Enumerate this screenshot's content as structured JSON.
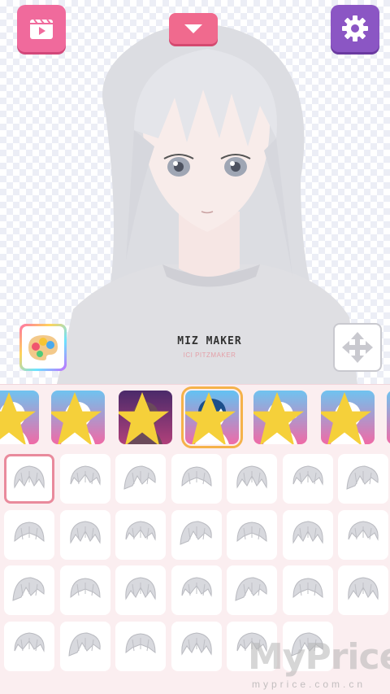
{
  "toolbar": {
    "video_icon": "video-icon",
    "dropdown_icon": "chevron-down-icon",
    "settings_icon": "gear-icon",
    "palette_icon": "palette-icon",
    "move_icon": "move-arrows-icon"
  },
  "character": {
    "shirt_text": "MIZ MAKER",
    "shirt_subtext": "ICI PITZMAKER"
  },
  "categories": [
    {
      "name": "face-base-1",
      "premium": true
    },
    {
      "name": "face-blush",
      "premium": true
    },
    {
      "name": "face-dark",
      "premium": true
    },
    {
      "name": "hair-selected",
      "premium": true,
      "selected": true
    },
    {
      "name": "face-ears",
      "premium": true
    },
    {
      "name": "face-plain",
      "premium": true
    }
  ],
  "hair_items": {
    "count": 27,
    "selected_index": 0
  },
  "watermark": {
    "text": "MyPrice",
    "subtext": "myprice.com.cn"
  },
  "colors": {
    "pink": "#f06a9c",
    "purple": "#8b56c4",
    "panel_bg": "#fbeef0",
    "selected_border": "#e98a9c",
    "category_selected": "#f5b24a"
  }
}
